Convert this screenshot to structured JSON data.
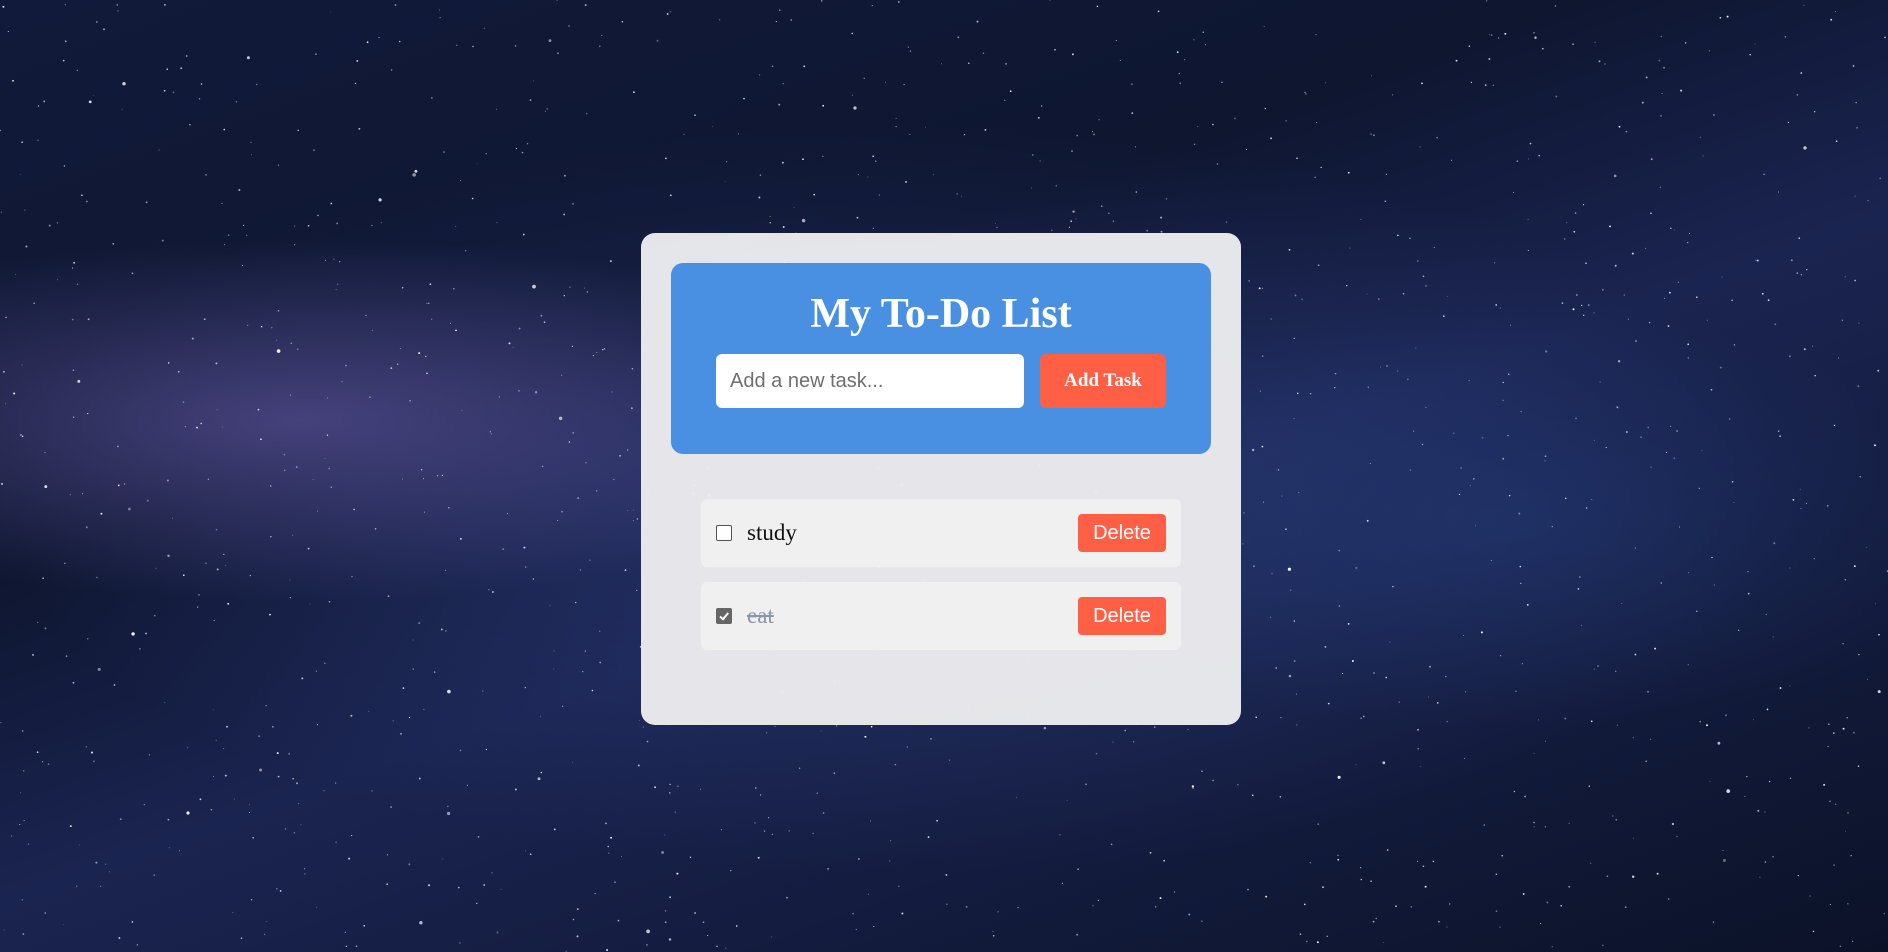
{
  "header": {
    "title": "My To-Do List"
  },
  "add_form": {
    "placeholder": "Add a new task...",
    "value": "",
    "add_button_label": "Add Task"
  },
  "tasks": [
    {
      "text": "study",
      "done": false,
      "delete_label": "Delete"
    },
    {
      "text": "eat",
      "done": true,
      "delete_label": "Delete"
    }
  ],
  "colors": {
    "header_bg": "#4a90e2",
    "accent_button": "#ff5f45",
    "card_bg": "#ececee",
    "completed_text": "#8a97aa"
  },
  "icons": {
    "checkbox_checked": "checkmark-icon"
  }
}
